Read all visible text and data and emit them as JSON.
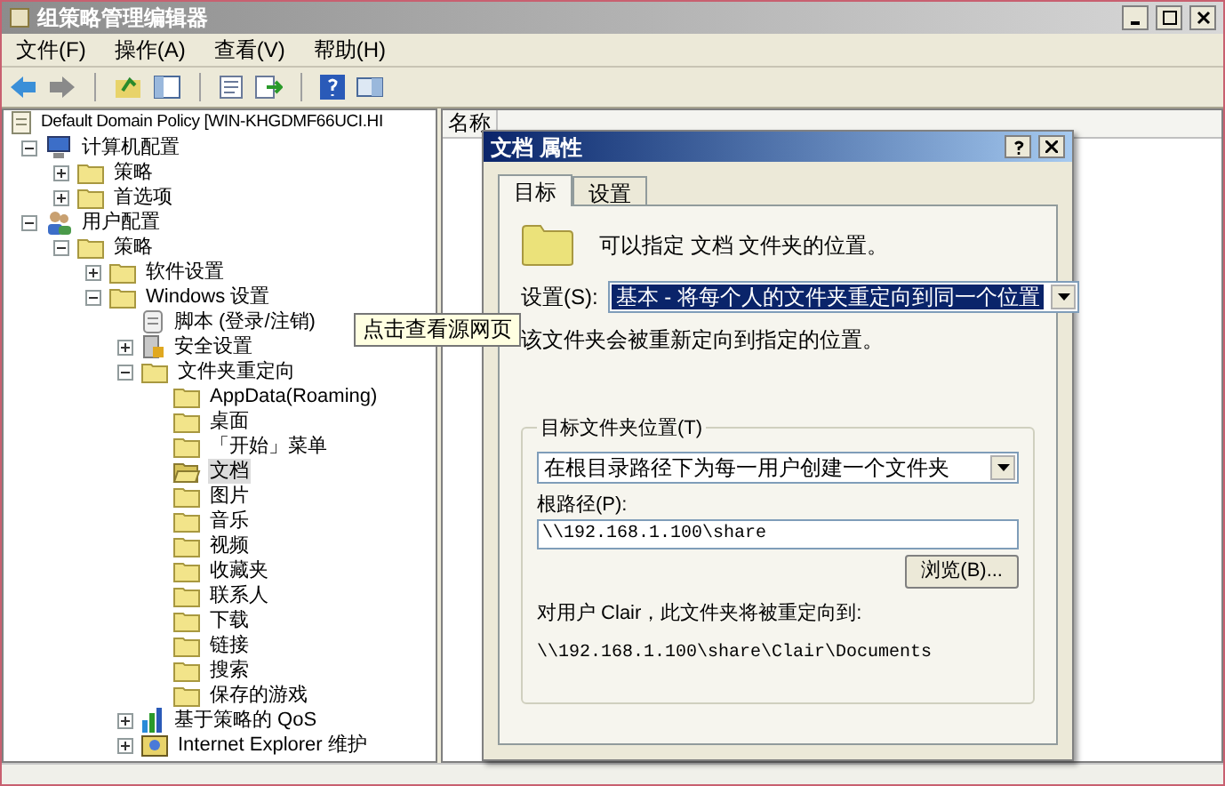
{
  "window": {
    "title": "组策略管理编辑器",
    "active": false
  },
  "menu": [
    "文件(F)",
    "操作(A)",
    "查看(V)",
    "帮助(H)"
  ],
  "toolbar": [
    {
      "kind": "back"
    },
    {
      "kind": "forward"
    },
    {
      "kind": "sep"
    },
    {
      "kind": "up"
    },
    {
      "kind": "tree"
    },
    {
      "kind": "sep"
    },
    {
      "kind": "properties"
    },
    {
      "kind": "export"
    },
    {
      "kind": "sep"
    },
    {
      "kind": "help"
    },
    {
      "kind": "view"
    }
  ],
  "tree": [
    {
      "label": "Default Domain Policy [WIN-KHGDMF66UCI.HI",
      "kind": "policy",
      "selected": false,
      "children": [
        {
          "label": "计算机配置",
          "kind": "computer",
          "selected": false,
          "expanded": true,
          "children": [
            {
              "label": "策略",
              "kind": "folder",
              "selected": false,
              "expanded": false
            },
            {
              "label": "首选项",
              "kind": "folder",
              "selected": false,
              "expanded": false
            }
          ]
        },
        {
          "label": "用户配置",
          "kind": "user",
          "selected": false,
          "expanded": true,
          "children": [
            {
              "label": "策略",
              "kind": "folder",
              "selected": false,
              "expanded": true,
              "children": [
                {
                  "label": "软件设置",
                  "kind": "folder",
                  "selected": false,
                  "expanded": false
                },
                {
                  "label": "Windows 设置",
                  "kind": "folder",
                  "selected": false,
                  "expanded": true,
                  "children": [
                    {
                      "label": "脚本 (登录/注销)",
                      "kind": "script",
                      "selected": false
                    },
                    {
                      "label": "安全设置",
                      "kind": "security",
                      "selected": false,
                      "expanded": false
                    },
                    {
                      "label": "文件夹重定向",
                      "kind": "folder",
                      "selected": false,
                      "expanded": true,
                      "children": [
                        {
                          "label": "AppData(Roaming)",
                          "kind": "folder",
                          "selected": false
                        },
                        {
                          "label": "桌面",
                          "kind": "folder",
                          "selected": false
                        },
                        {
                          "label": "「开始」菜单",
                          "kind": "folder",
                          "selected": false
                        },
                        {
                          "label": "文档",
                          "kind": "folder",
                          "selected": true
                        },
                        {
                          "label": "图片",
                          "kind": "folder",
                          "selected": false
                        },
                        {
                          "label": "音乐",
                          "kind": "folder",
                          "selected": false
                        },
                        {
                          "label": "视频",
                          "kind": "folder",
                          "selected": false
                        },
                        {
                          "label": "收藏夹",
                          "kind": "folder",
                          "selected": false
                        },
                        {
                          "label": "联系人",
                          "kind": "folder",
                          "selected": false
                        },
                        {
                          "label": "下载",
                          "kind": "folder",
                          "selected": false
                        },
                        {
                          "label": "链接",
                          "kind": "folder",
                          "selected": false
                        },
                        {
                          "label": "搜索",
                          "kind": "folder",
                          "selected": false
                        },
                        {
                          "label": "保存的游戏",
                          "kind": "folder",
                          "selected": false
                        }
                      ]
                    },
                    {
                      "label": "基于策略的 QoS",
                      "kind": "qos",
                      "selected": false,
                      "expanded": false
                    },
                    {
                      "label": "Internet Explorer 维护",
                      "kind": "ie",
                      "selected": false,
                      "expanded": false
                    }
                  ]
                }
              ]
            }
          ]
        }
      ]
    }
  ],
  "list": {
    "columns": [
      "名称"
    ]
  },
  "tooltip": "点击查看源网页",
  "dialog": {
    "title": "文档 属性",
    "tabs": [
      {
        "label": "目标",
        "selected": true
      },
      {
        "label": "设置",
        "selected": false
      }
    ],
    "intro": "可以指定 文档 文件夹的位置。",
    "setting": {
      "label": "设置(S):",
      "value": "基本 - 将每个人的文件夹重定向到同一个位置",
      "focused": true
    },
    "note": "该文件夹会被重新定向到指定的位置。",
    "group": {
      "title": "目标文件夹位置(T)",
      "location": "在根目录路径下为每一用户创建一个文件夹",
      "root_label": "根路径(P):",
      "root_value": "\\\\192.168.1.100\\share",
      "browse": "浏览(B)...",
      "result_label": "对用户 Clair，此文件夹将被重定向到:",
      "result_path": "\\\\192.168.1.100\\share\\Clair\\Documents"
    }
  }
}
